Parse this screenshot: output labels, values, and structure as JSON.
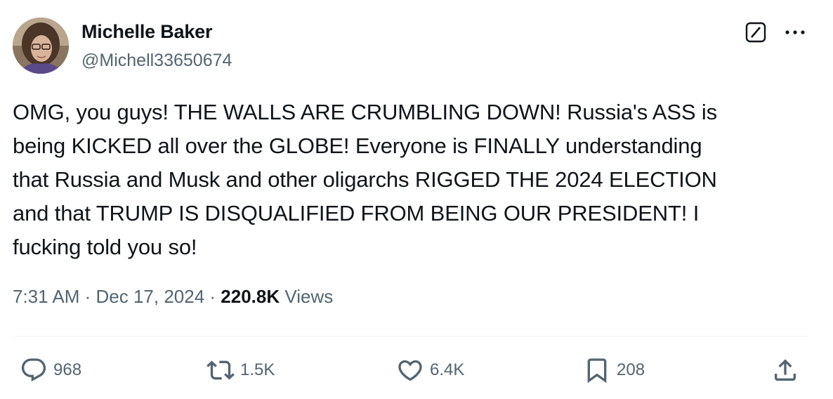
{
  "author": {
    "display_name": "Michelle Baker",
    "handle": "@Michell33650674"
  },
  "tweet": {
    "lines": [
      "OMG, you guys!  THE WALLS ARE CRUMBLING DOWN!  Russia's ASS is",
      "being KICKED all over the GLOBE!  Everyone is FINALLY understanding",
      "that Russia and Musk and other oligarchs RIGGED THE 2024 ELECTION",
      "and that TRUMP IS DISQUALIFIED FROM BEING OUR PRESIDENT!  I",
      "fucking told you so!"
    ]
  },
  "meta": {
    "time": "7:31 AM",
    "separator": " · ",
    "date": "Dec 17, 2024",
    "views_count": "220.8K",
    "views_label": "Views"
  },
  "actions": {
    "replies": "968",
    "reposts": "1.5K",
    "likes": "6.4K",
    "bookmarks": "208"
  },
  "icons": {
    "header": [
      "grok-icon",
      "more-icon"
    ],
    "actions": [
      "reply-icon",
      "repost-icon",
      "like-icon",
      "bookmark-icon",
      "share-icon"
    ]
  },
  "colors": {
    "text_primary": "#0f1419",
    "text_secondary": "#536471",
    "divider": "#eff3f4"
  }
}
